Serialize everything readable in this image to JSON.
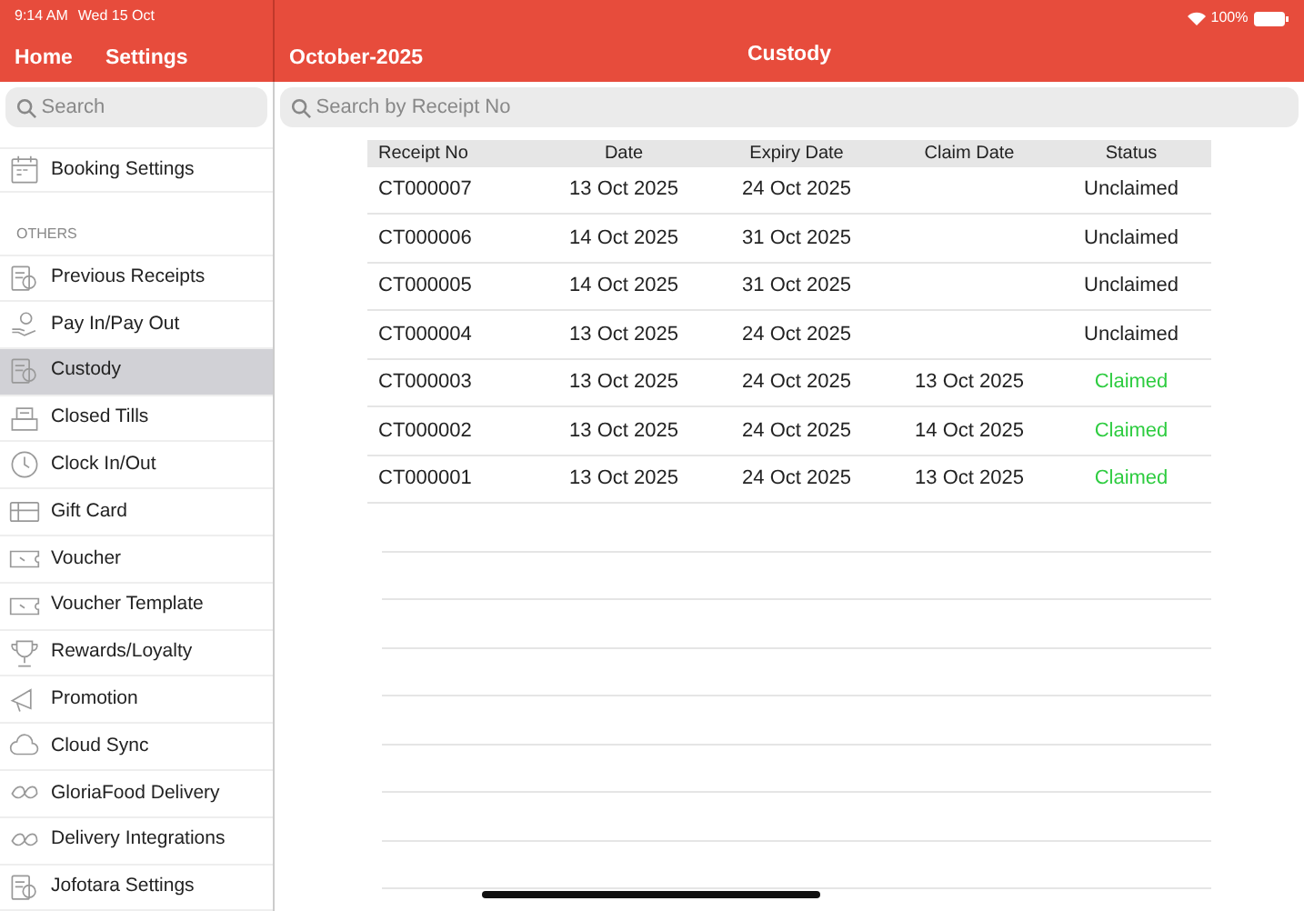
{
  "status_bar": {
    "time": "9:14 AM",
    "date": "Wed 15 Oct",
    "battery": "100%"
  },
  "nav": {
    "home": "Home",
    "settings": "Settings",
    "period": "October-2025",
    "title": "Custody"
  },
  "sidebar": {
    "search_placeholder": "Search",
    "top_item": "Booking Settings",
    "section": "OTHERS",
    "items": [
      {
        "label": "Previous Receipts",
        "selected": false
      },
      {
        "label": "Pay In/Pay Out",
        "selected": false
      },
      {
        "label": "Custody",
        "selected": true
      },
      {
        "label": "Closed Tills",
        "selected": false
      },
      {
        "label": "Clock In/Out",
        "selected": false
      },
      {
        "label": "Gift Card",
        "selected": false
      },
      {
        "label": "Voucher",
        "selected": false
      },
      {
        "label": "Voucher Template",
        "selected": false
      },
      {
        "label": "Rewards/Loyalty",
        "selected": false
      },
      {
        "label": "Promotion",
        "selected": false
      },
      {
        "label": "Cloud Sync",
        "selected": false
      },
      {
        "label": "GloriaFood Delivery",
        "selected": false
      },
      {
        "label": "Delivery Integrations",
        "selected": false
      },
      {
        "label": "Jofotara Settings",
        "selected": false
      }
    ]
  },
  "search": {
    "placeholder": "Search by Receipt No"
  },
  "table": {
    "columns": [
      "Receipt No",
      "Date",
      "Expiry Date",
      "Claim Date",
      "Status"
    ],
    "rows": [
      {
        "cells": [
          "CT000007",
          "13 Oct 2025",
          "24 Oct 2025",
          "",
          "Unclaimed"
        ],
        "kind": "unclaimed"
      },
      {
        "cells": [
          "CT000006",
          "14 Oct 2025",
          "31 Oct 2025",
          "",
          "Unclaimed"
        ],
        "kind": "unclaimed"
      },
      {
        "cells": [
          "CT000005",
          "14 Oct 2025",
          "31 Oct 2025",
          "",
          "Unclaimed"
        ],
        "kind": "unclaimed"
      },
      {
        "cells": [
          "CT000004",
          "13 Oct 2025",
          "24 Oct 2025",
          "",
          "Unclaimed"
        ],
        "kind": "unclaimed"
      },
      {
        "cells": [
          "CT000003",
          "13 Oct 2025",
          "24 Oct 2025",
          "13 Oct 2025",
          "Claimed"
        ],
        "kind": "claimed"
      },
      {
        "cells": [
          "CT000002",
          "13 Oct 2025",
          "24 Oct 2025",
          "14 Oct 2025",
          "Claimed"
        ],
        "kind": "claimed"
      },
      {
        "cells": [
          "CT000001",
          "13 Oct 2025",
          "24 Oct 2025",
          "13 Oct 2025",
          "Claimed"
        ],
        "kind": "claimed"
      }
    ]
  }
}
